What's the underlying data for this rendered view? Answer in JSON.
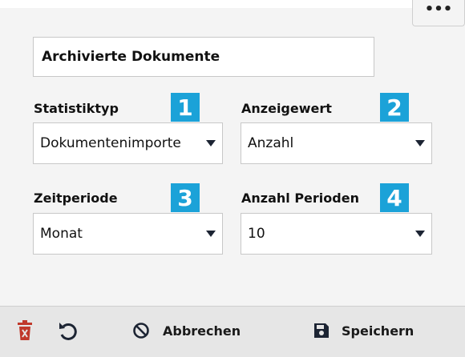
{
  "title_field": {
    "value": "Archivierte Dokumente"
  },
  "more_menu": {
    "label": "•••"
  },
  "fields": [
    {
      "label": "Statistiktyp",
      "value": "Dokumentenimporte",
      "badge": "1"
    },
    {
      "label": "Anzeigewert",
      "value": "Anzahl",
      "badge": "2"
    },
    {
      "label": "Zeitperiode",
      "value": "Monat",
      "badge": "3"
    },
    {
      "label": "Anzahl Perioden",
      "value": "10",
      "badge": "4"
    }
  ],
  "footer": {
    "cancel_label": "Abbrechen",
    "save_label": "Speichern"
  },
  "colors": {
    "accent": "#1ba2d8",
    "delete": "#c0392b"
  },
  "icons": [
    "more-icon",
    "trash-icon",
    "undo-icon",
    "cancel-icon",
    "save-icon",
    "caret-down-icon"
  ]
}
